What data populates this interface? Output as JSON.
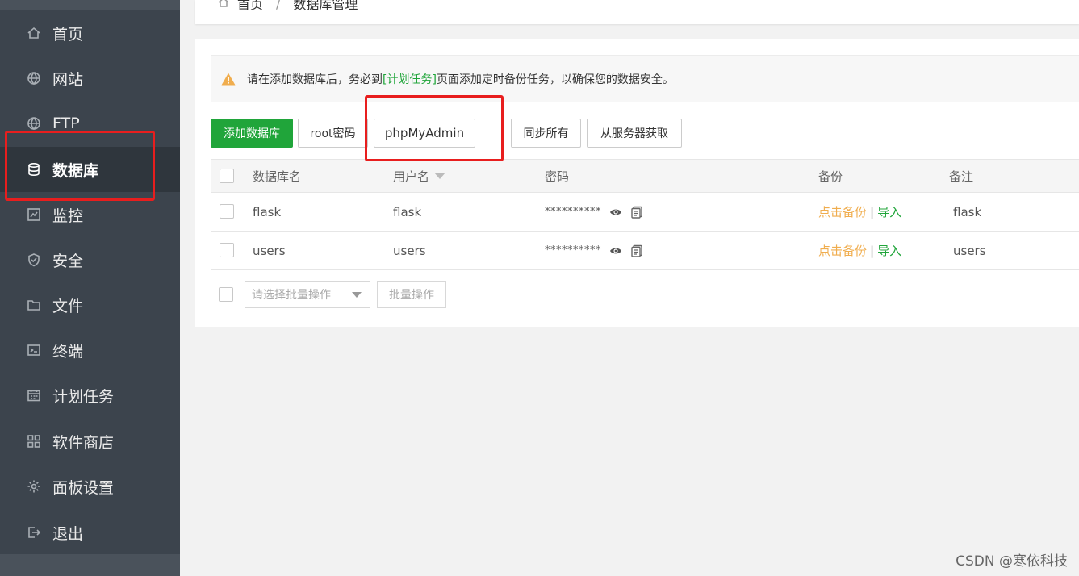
{
  "sidebar": {
    "items": [
      {
        "label": "首页",
        "icon": "home-icon"
      },
      {
        "label": "网站",
        "icon": "globe-icon"
      },
      {
        "label": "FTP",
        "icon": "ftp-globe-icon"
      },
      {
        "label": "数据库",
        "icon": "database-icon",
        "active": true
      },
      {
        "label": "监控",
        "icon": "monitor-icon"
      },
      {
        "label": "安全",
        "icon": "shield-icon"
      },
      {
        "label": "文件",
        "icon": "folder-icon"
      },
      {
        "label": "终端",
        "icon": "terminal-icon"
      },
      {
        "label": "计划任务",
        "icon": "calendar-icon"
      },
      {
        "label": "软件商店",
        "icon": "grid-icon"
      },
      {
        "label": "面板设置",
        "icon": "gear-icon"
      },
      {
        "label": "退出",
        "icon": "logout-icon"
      }
    ]
  },
  "breadcrumb": {
    "home": "首页",
    "separator": "/",
    "current": "数据库管理"
  },
  "notice": {
    "before": "请在添加数据库后，务必到",
    "link": "[计划任务]",
    "after": "页面添加定时备份任务，以确保您的数据安全。"
  },
  "toolbar": {
    "add_db": "添加数据库",
    "root_pw": "root密码",
    "phpmyadmin": "phpMyAdmin",
    "sync_all": "同步所有",
    "fetch_server": "从服务器获取"
  },
  "table": {
    "headers": {
      "name": "数据库名",
      "user": "用户名",
      "password": "密码",
      "backup": "备份",
      "note": "备注"
    },
    "rows": [
      {
        "name": "flask",
        "user": "flask",
        "password": "**********",
        "backup": "点击备份",
        "sep": "|",
        "import": "导入",
        "note": "flask"
      },
      {
        "name": "users",
        "user": "users",
        "password": "**********",
        "backup": "点击备份",
        "sep": "|",
        "import": "导入",
        "note": "users"
      }
    ]
  },
  "batch": {
    "placeholder": "请选择批量操作",
    "button": "批量操作"
  },
  "watermark": "CSDN @寒依科技",
  "colors": {
    "accent": "#20a53a",
    "sidebar": "#3c444d",
    "highlight": "#e81e1e",
    "orange": "#f0ad4e"
  }
}
